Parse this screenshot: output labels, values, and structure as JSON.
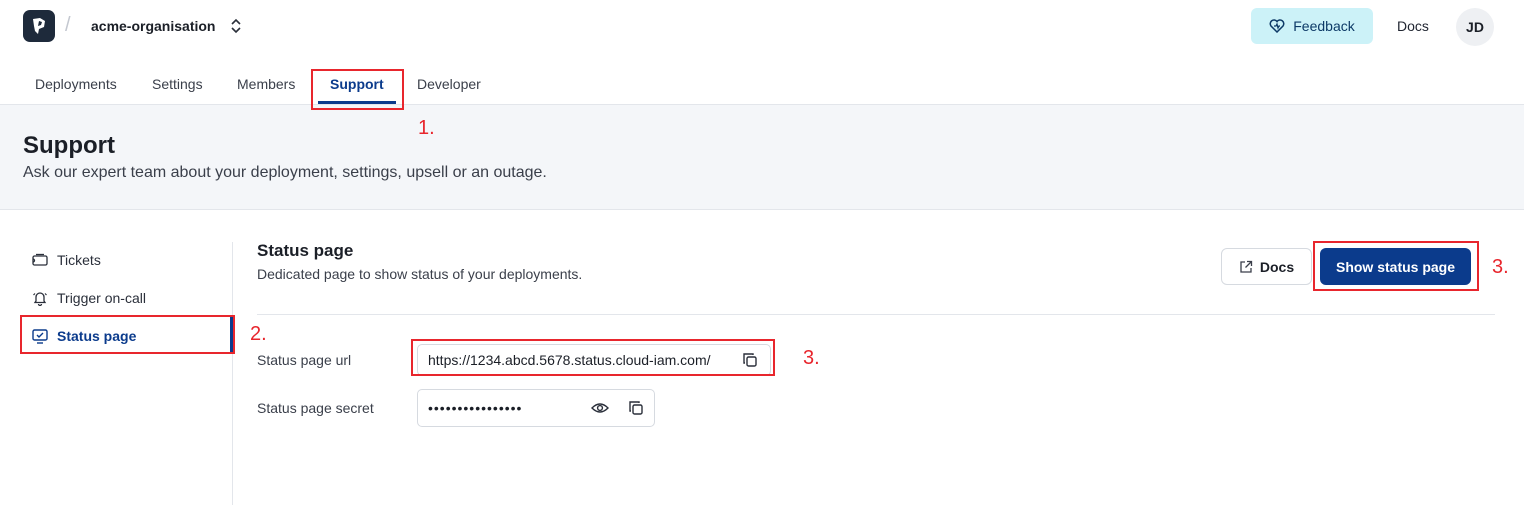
{
  "header": {
    "org_name": "acme-organisation",
    "feedback_label": "Feedback",
    "docs_label": "Docs",
    "avatar_initials": "JD"
  },
  "tabs": [
    {
      "label": "Deployments"
    },
    {
      "label": "Settings"
    },
    {
      "label": "Members"
    },
    {
      "label": "Support",
      "active": true
    },
    {
      "label": "Developer"
    }
  ],
  "page": {
    "title": "Support",
    "subtitle": "Ask our expert team about your deployment, settings, upsell or an outage."
  },
  "sidebar": {
    "items": [
      {
        "label": "Tickets",
        "icon": "ticket-icon"
      },
      {
        "label": "Trigger on-call",
        "icon": "bell-icon"
      },
      {
        "label": "Status page",
        "icon": "monitor-icon",
        "active": true
      }
    ]
  },
  "section": {
    "title": "Status page",
    "subtitle": "Dedicated page to show status of your deployments.",
    "docs_label": "Docs",
    "show_button_label": "Show status page"
  },
  "fields": {
    "url_label": "Status page url",
    "url_value": "https://1234.abcd.5678.status.cloud-iam.com/",
    "secret_label": "Status page secret",
    "secret_value": "••••••••••••••••"
  },
  "annotations": {
    "step1": "1.",
    "step2": "2.",
    "step3": "3."
  },
  "colors": {
    "accent": "#0b3b8c",
    "feedback_bg": "#ccf2f8",
    "highlight": "#e8262d"
  }
}
